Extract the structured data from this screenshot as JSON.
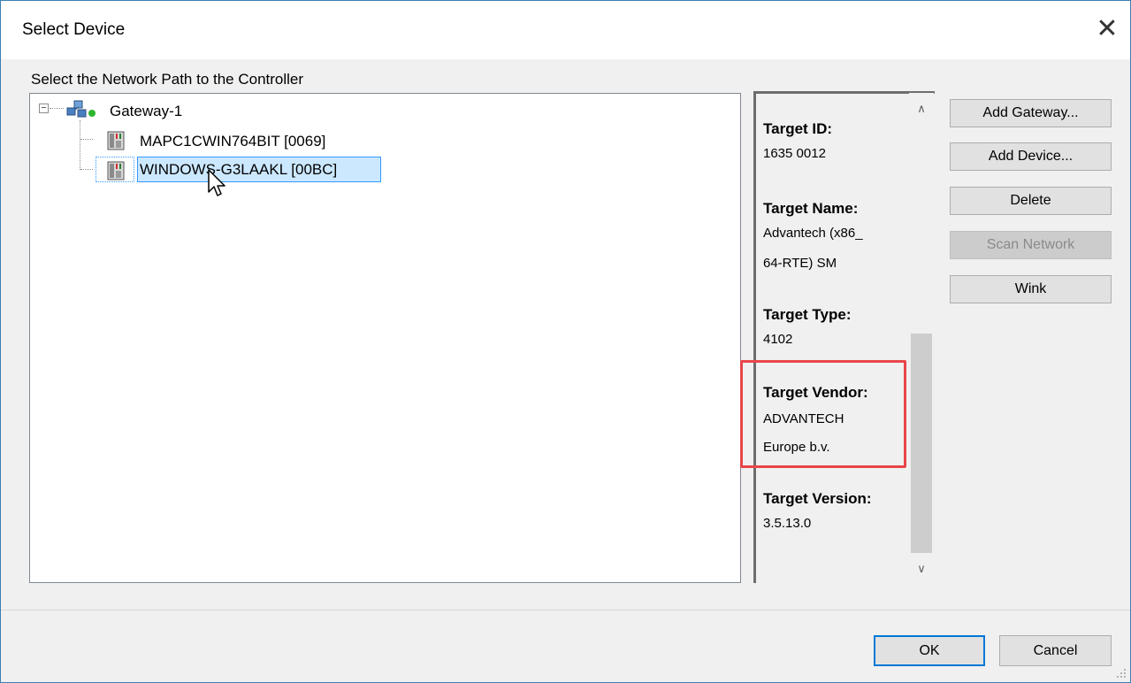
{
  "window": {
    "title": "Select Device",
    "close_glyph": "✕"
  },
  "tree_section": {
    "label": "Select the Network Path to the Controller",
    "gateway": {
      "label": "Gateway-1",
      "expander": "−",
      "status_color": "#2db52d"
    },
    "devices": [
      {
        "label": "MAPC1CWIN764BIT [0069]",
        "selected": false
      },
      {
        "label": "WINDOWS-G3LAAKL [00BC]",
        "selected": true
      }
    ]
  },
  "info_panel": {
    "fields": [
      {
        "heading": "Target ID:",
        "value_lines": [
          "1635 0012"
        ]
      },
      {
        "heading": "Target Name:",
        "value_lines": [
          "Advantech (x86_",
          "64-RTE) SM"
        ]
      },
      {
        "heading": "Target Type:",
        "value_lines": [
          "4102"
        ]
      },
      {
        "heading": "Target Vendor:",
        "value_lines": [
          "ADVANTECH",
          "Europe b.v."
        ]
      },
      {
        "heading": "Target Version:",
        "value_lines": [
          "3.5.13.0"
        ]
      }
    ],
    "highlight_color": "#e8464a"
  },
  "side_buttons": {
    "add_gateway": "Add Gateway...",
    "add_device": "Add Device...",
    "delete": "Delete",
    "scan_network": "Scan Network",
    "wink": "Wink"
  },
  "footer": {
    "ok": "OK",
    "cancel": "Cancel"
  }
}
